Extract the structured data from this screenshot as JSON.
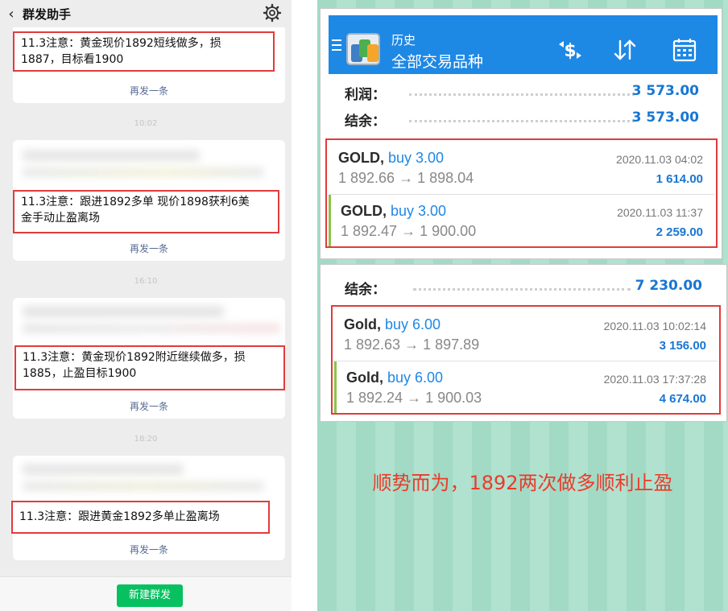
{
  "wechat": {
    "title": "群发助手",
    "resend_label": "再发一条",
    "new_broadcast_label": "新建群发",
    "timestamps": [
      "10:02",
      "16:10",
      "18:20"
    ],
    "messages": [
      {
        "text": "11.3注意：黄金现价1892短线做多，损\n1887，目标看1900"
      },
      {
        "text": "11.3注意：跟进1892多单 现价1898获利6美\n金手动止盈离场"
      },
      {
        "text": "11.3注意：黄金现价1892附近继续做多，损\n1885，止盈目标1900"
      },
      {
        "text": "11.3注意：跟进黄金1892多单止盈离场"
      }
    ]
  },
  "mt_top": {
    "subtitle": "历史",
    "title": "全部交易品种",
    "rows": [
      {
        "label": "利润：",
        "value": "3 573.00"
      },
      {
        "label": "结余：",
        "value": "3 573.00"
      }
    ],
    "trades": [
      {
        "symbol": "GOLD,",
        "side": "buy 3.00",
        "prices": "1 892.66 → 1 898.04",
        "time": "2020.11.03 04:02",
        "profit": "1 614.00"
      },
      {
        "symbol": "GOLD,",
        "side": "buy 3.00",
        "prices": "1 892.47 → 1 900.00",
        "time": "2020.11.03 11:37",
        "profit": "2 259.00"
      }
    ]
  },
  "mt_bottom": {
    "balance_label": "结余：",
    "balance_value": "7 230.00",
    "trades": [
      {
        "symbol": "Gold,",
        "side": "buy 6.00",
        "prices": "1 892.63 → 1 897.89",
        "time": "2020.11.03 10:02:14",
        "profit": "3 156.00"
      },
      {
        "symbol": "Gold,",
        "side": "buy 6.00",
        "prices": "1 892.24 → 1 900.03",
        "time": "2020.11.03 17:37:28",
        "profit": "4 674.00"
      }
    ]
  },
  "caption": "顺势而为，1892两次做多顺利止盈",
  "colors": {
    "accent_red": "#e23b3b",
    "mt_blue": "#1e88e5",
    "wechat_green": "#07c160"
  },
  "icons": [
    "back-icon",
    "gear-icon",
    "menu-icon",
    "metatrader-logo-icon",
    "currency-exchange-icon",
    "sort-icon",
    "calendar-icon"
  ]
}
